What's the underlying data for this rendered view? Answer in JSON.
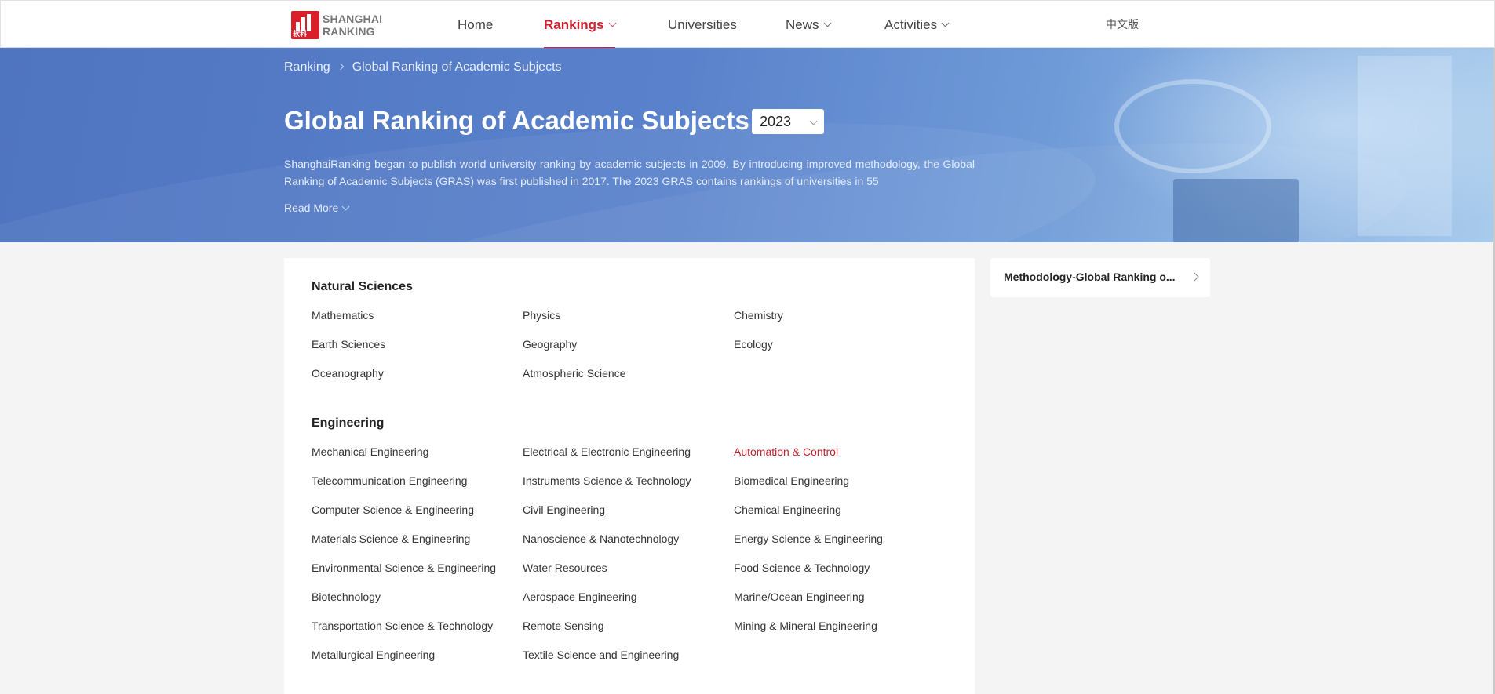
{
  "header": {
    "logo": {
      "line1": "SHANGHAI",
      "line2": "RANKING",
      "mark_text": "软科"
    },
    "nav": [
      {
        "label": "Home",
        "dropdown": false,
        "active": false
      },
      {
        "label": "Rankings",
        "dropdown": true,
        "active": true
      },
      {
        "label": "Universities",
        "dropdown": false,
        "active": false
      },
      {
        "label": "News",
        "dropdown": true,
        "active": false
      },
      {
        "label": "Activities",
        "dropdown": true,
        "active": false
      }
    ],
    "language": "中文版"
  },
  "banner": {
    "breadcrumb": [
      "Ranking",
      "Global Ranking of Academic Subjects"
    ],
    "title": "Global Ranking of Academic Subjects",
    "year": "2023",
    "description": "ShanghaiRanking began to publish world university ranking by academic subjects in 2009. By introducing improved methodology, the Global Ranking of Academic Subjects (GRAS) was first published in 2017. The 2023 GRAS contains rankings of universities in 55",
    "read_more": "Read More"
  },
  "sections": [
    {
      "title": "Natural Sciences",
      "subjects": [
        "Mathematics",
        "Physics",
        "Chemistry",
        "Earth Sciences",
        "Geography",
        "Ecology",
        "Oceanography",
        "Atmospheric Science"
      ]
    },
    {
      "title": "Engineering",
      "subjects": [
        "Mechanical Engineering",
        "Electrical & Electronic Engineering",
        "Automation & Control",
        "Telecommunication Engineering",
        "Instruments Science & Technology",
        "Biomedical Engineering",
        "Computer Science & Engineering",
        "Civil Engineering",
        "Chemical Engineering",
        "Materials Science & Engineering",
        "Nanoscience & Nanotechnology",
        "Energy Science & Engineering",
        "Environmental Science & Engineering",
        "Water Resources",
        "Food Science & Technology",
        "Biotechnology",
        "Aerospace Engineering",
        "Marine/Ocean Engineering",
        "Transportation Science & Technology",
        "Remote Sensing",
        "Mining & Mineral Engineering",
        "Metallurgical Engineering",
        "Textile Science and Engineering"
      ],
      "highlighted": "Automation & Control"
    }
  ],
  "side": {
    "label": "Methodology-Global Ranking o..."
  },
  "colors": {
    "accent": "#cf1f2e",
    "highlight_link": "#c0232c",
    "banner": "#5a82cc"
  }
}
